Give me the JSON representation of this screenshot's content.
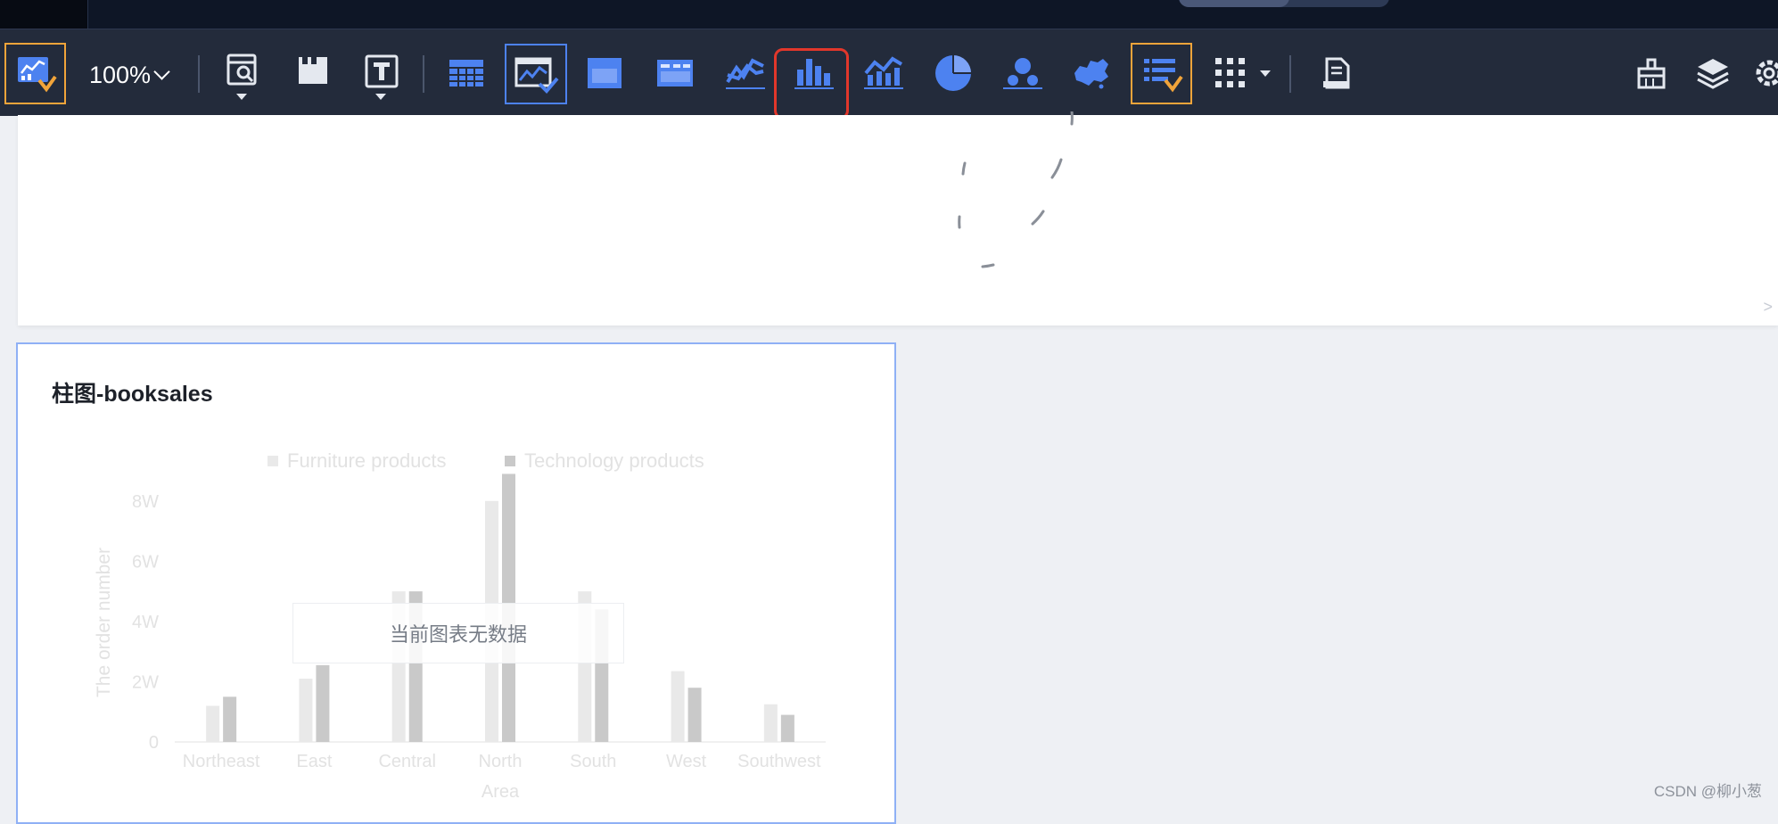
{
  "toolbar": {
    "zoom": "100%",
    "items": [
      {
        "name": "dashboard-theme-icon"
      },
      {
        "name": "query-filter-icon"
      },
      {
        "name": "tab-container-icon"
      },
      {
        "name": "text-component-icon"
      },
      {
        "name": "table-component-icon"
      },
      {
        "name": "chart-widget-icon"
      },
      {
        "name": "container-icon"
      },
      {
        "name": "indicator-card-icon"
      },
      {
        "name": "line-chart-icon"
      },
      {
        "name": "bar-chart-icon"
      },
      {
        "name": "combo-chart-icon"
      },
      {
        "name": "pie-chart-icon"
      },
      {
        "name": "scatter-chart-icon"
      },
      {
        "name": "map-chart-icon"
      },
      {
        "name": "list-component-icon"
      },
      {
        "name": "more-components-icon"
      },
      {
        "name": "report-icon"
      },
      {
        "name": "clear-brush-icon"
      },
      {
        "name": "layers-icon"
      },
      {
        "name": "settings-gear-icon"
      }
    ],
    "highlighted": "bar-chart-icon"
  },
  "card": {
    "title": "柱图-booksales",
    "no_data": "当前图表无数据"
  },
  "chart_data": {
    "type": "bar",
    "title": "柱图-booksales",
    "xlabel": "Area",
    "ylabel": "The order number",
    "categories": [
      "Northeast",
      "East",
      "Central",
      "North",
      "South",
      "West",
      "Southwest"
    ],
    "series": [
      {
        "name": "Furniture products",
        "values": [
          12000,
          21000,
          50000,
          80000,
          50000,
          23500,
          12500
        ]
      },
      {
        "name": "Technology products",
        "values": [
          15000,
          25500,
          50000,
          89000,
          44000,
          18000,
          9000
        ]
      }
    ],
    "ylim": [
      0,
      90000
    ],
    "yticks": [
      {
        "value": 0,
        "label": "0"
      },
      {
        "value": 20000,
        "label": "2W"
      },
      {
        "value": 40000,
        "label": "4W"
      },
      {
        "value": 60000,
        "label": "6W"
      },
      {
        "value": 80000,
        "label": "8W"
      }
    ],
    "legend": "top-center",
    "colors": [
      "#e9e9e9",
      "#c9c9c9"
    ]
  },
  "watermark": "CSDN @柳小葱"
}
